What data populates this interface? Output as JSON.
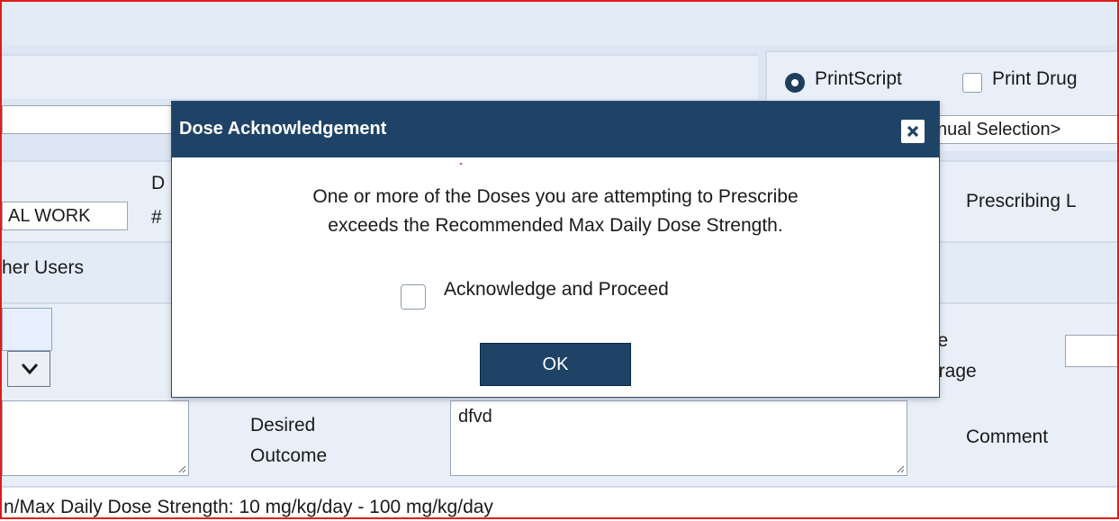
{
  "print_options": {
    "printscript_label": "PrintScript",
    "printdrug_label": "Print Drug"
  },
  "manual_select": {
    "value": "nual Selection>"
  },
  "form": {
    "al_work_value": "AL WORK",
    "d_label": "D",
    "hash_label": "#",
    "prescribing_label": "Prescribing L",
    "other_users_label": "her Users",
    "ve_label_line1": "ve",
    "ve_label_line2": "erage",
    "desired_outcome_line1": "Desired",
    "desired_outcome_line2": "Outcome",
    "desired_outcome_value": "dfvd",
    "comment_label": "Comment",
    "dose_strength_text": "n/Max Daily Dose Strength: 10 mg/kg/day - 100 mg/kg/day"
  },
  "modal": {
    "title": "Dose Acknowledgement",
    "message_line1": "One or more of the Doses you are attempting to Prescribe",
    "message_line2": "exceeds the Recommended Max Daily Dose Strength.",
    "checkbox_label": "Acknowledge and Proceed",
    "ok_label": "OK"
  },
  "icons": {
    "close": "close-icon",
    "chevron": "chevron-down-icon",
    "radio": "radio-selected-icon"
  },
  "colors": {
    "header": "#1f4366",
    "border_highlight": "#e11b1b",
    "background": "#dde6f3"
  }
}
